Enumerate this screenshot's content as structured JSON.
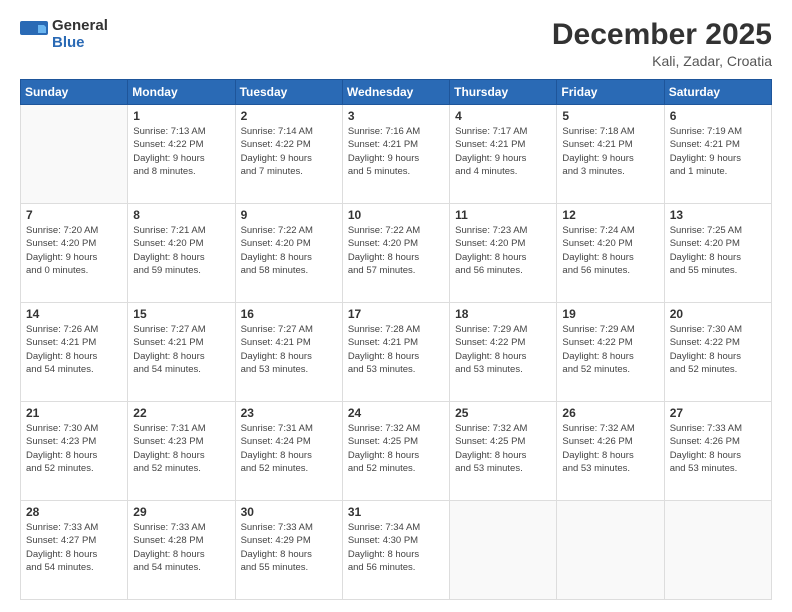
{
  "logo": {
    "general": "General",
    "blue": "Blue"
  },
  "header": {
    "title": "December 2025",
    "subtitle": "Kali, Zadar, Croatia"
  },
  "weekdays": [
    "Sunday",
    "Monday",
    "Tuesday",
    "Wednesday",
    "Thursday",
    "Friday",
    "Saturday"
  ],
  "weeks": [
    [
      {
        "day": "",
        "info": ""
      },
      {
        "day": "1",
        "info": "Sunrise: 7:13 AM\nSunset: 4:22 PM\nDaylight: 9 hours\nand 8 minutes."
      },
      {
        "day": "2",
        "info": "Sunrise: 7:14 AM\nSunset: 4:22 PM\nDaylight: 9 hours\nand 7 minutes."
      },
      {
        "day": "3",
        "info": "Sunrise: 7:16 AM\nSunset: 4:21 PM\nDaylight: 9 hours\nand 5 minutes."
      },
      {
        "day": "4",
        "info": "Sunrise: 7:17 AM\nSunset: 4:21 PM\nDaylight: 9 hours\nand 4 minutes."
      },
      {
        "day": "5",
        "info": "Sunrise: 7:18 AM\nSunset: 4:21 PM\nDaylight: 9 hours\nand 3 minutes."
      },
      {
        "day": "6",
        "info": "Sunrise: 7:19 AM\nSunset: 4:21 PM\nDaylight: 9 hours\nand 1 minute."
      }
    ],
    [
      {
        "day": "7",
        "info": "Sunrise: 7:20 AM\nSunset: 4:20 PM\nDaylight: 9 hours\nand 0 minutes."
      },
      {
        "day": "8",
        "info": "Sunrise: 7:21 AM\nSunset: 4:20 PM\nDaylight: 8 hours\nand 59 minutes."
      },
      {
        "day": "9",
        "info": "Sunrise: 7:22 AM\nSunset: 4:20 PM\nDaylight: 8 hours\nand 58 minutes."
      },
      {
        "day": "10",
        "info": "Sunrise: 7:22 AM\nSunset: 4:20 PM\nDaylight: 8 hours\nand 57 minutes."
      },
      {
        "day": "11",
        "info": "Sunrise: 7:23 AM\nSunset: 4:20 PM\nDaylight: 8 hours\nand 56 minutes."
      },
      {
        "day": "12",
        "info": "Sunrise: 7:24 AM\nSunset: 4:20 PM\nDaylight: 8 hours\nand 56 minutes."
      },
      {
        "day": "13",
        "info": "Sunrise: 7:25 AM\nSunset: 4:20 PM\nDaylight: 8 hours\nand 55 minutes."
      }
    ],
    [
      {
        "day": "14",
        "info": "Sunrise: 7:26 AM\nSunset: 4:21 PM\nDaylight: 8 hours\nand 54 minutes."
      },
      {
        "day": "15",
        "info": "Sunrise: 7:27 AM\nSunset: 4:21 PM\nDaylight: 8 hours\nand 54 minutes."
      },
      {
        "day": "16",
        "info": "Sunrise: 7:27 AM\nSunset: 4:21 PM\nDaylight: 8 hours\nand 53 minutes."
      },
      {
        "day": "17",
        "info": "Sunrise: 7:28 AM\nSunset: 4:21 PM\nDaylight: 8 hours\nand 53 minutes."
      },
      {
        "day": "18",
        "info": "Sunrise: 7:29 AM\nSunset: 4:22 PM\nDaylight: 8 hours\nand 53 minutes."
      },
      {
        "day": "19",
        "info": "Sunrise: 7:29 AM\nSunset: 4:22 PM\nDaylight: 8 hours\nand 52 minutes."
      },
      {
        "day": "20",
        "info": "Sunrise: 7:30 AM\nSunset: 4:22 PM\nDaylight: 8 hours\nand 52 minutes."
      }
    ],
    [
      {
        "day": "21",
        "info": "Sunrise: 7:30 AM\nSunset: 4:23 PM\nDaylight: 8 hours\nand 52 minutes."
      },
      {
        "day": "22",
        "info": "Sunrise: 7:31 AM\nSunset: 4:23 PM\nDaylight: 8 hours\nand 52 minutes."
      },
      {
        "day": "23",
        "info": "Sunrise: 7:31 AM\nSunset: 4:24 PM\nDaylight: 8 hours\nand 52 minutes."
      },
      {
        "day": "24",
        "info": "Sunrise: 7:32 AM\nSunset: 4:25 PM\nDaylight: 8 hours\nand 52 minutes."
      },
      {
        "day": "25",
        "info": "Sunrise: 7:32 AM\nSunset: 4:25 PM\nDaylight: 8 hours\nand 53 minutes."
      },
      {
        "day": "26",
        "info": "Sunrise: 7:32 AM\nSunset: 4:26 PM\nDaylight: 8 hours\nand 53 minutes."
      },
      {
        "day": "27",
        "info": "Sunrise: 7:33 AM\nSunset: 4:26 PM\nDaylight: 8 hours\nand 53 minutes."
      }
    ],
    [
      {
        "day": "28",
        "info": "Sunrise: 7:33 AM\nSunset: 4:27 PM\nDaylight: 8 hours\nand 54 minutes."
      },
      {
        "day": "29",
        "info": "Sunrise: 7:33 AM\nSunset: 4:28 PM\nDaylight: 8 hours\nand 54 minutes."
      },
      {
        "day": "30",
        "info": "Sunrise: 7:33 AM\nSunset: 4:29 PM\nDaylight: 8 hours\nand 55 minutes."
      },
      {
        "day": "31",
        "info": "Sunrise: 7:34 AM\nSunset: 4:30 PM\nDaylight: 8 hours\nand 56 minutes."
      },
      {
        "day": "",
        "info": ""
      },
      {
        "day": "",
        "info": ""
      },
      {
        "day": "",
        "info": ""
      }
    ]
  ]
}
